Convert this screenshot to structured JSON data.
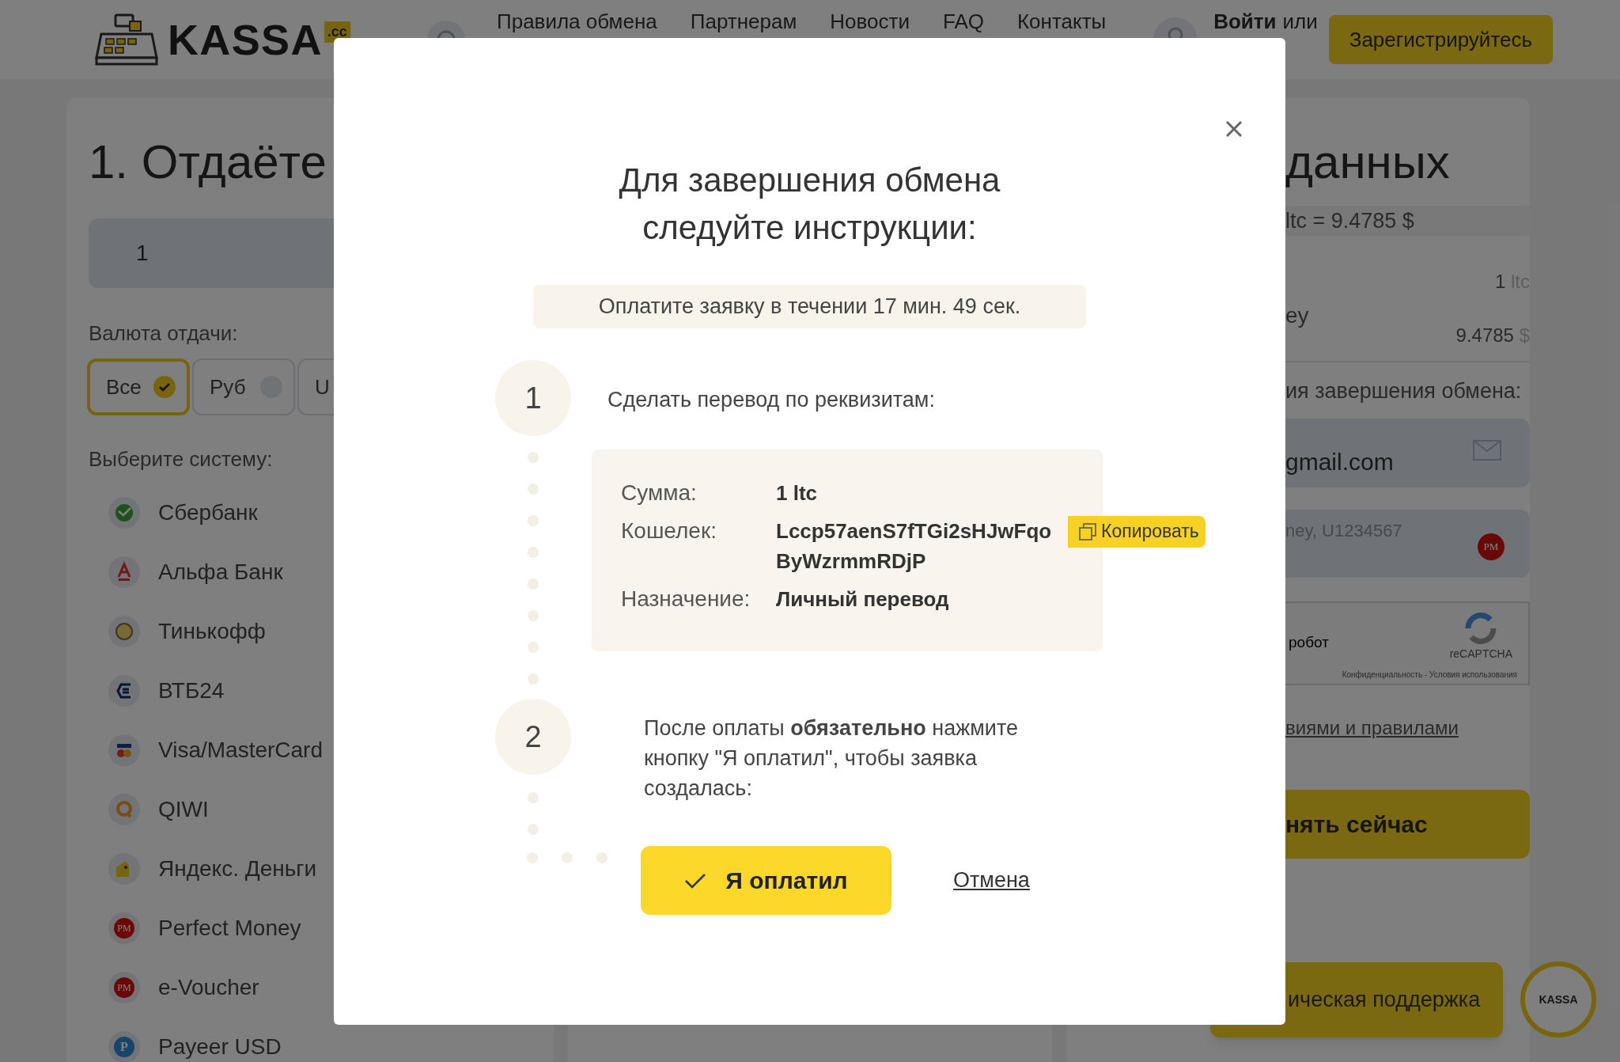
{
  "header": {
    "logo": "KASSA",
    "logo_badge": ".cc",
    "nav": [
      "Правила обмена",
      "Партнерам",
      "Новости",
      "FAQ",
      "Контакты"
    ],
    "login": "Войти",
    "or": "или",
    "register": "Зарегистрируйтесь"
  },
  "left_panel": {
    "title": "1. Отдаёте",
    "amount": "1",
    "currency_label": "Валюта отдачи:",
    "currency_chips": [
      {
        "label": "Все",
        "selected": true
      },
      {
        "label": "Руб",
        "selected": false
      },
      {
        "label": "U",
        "selected": false
      }
    ],
    "system_label": "Выберите систему:",
    "systems": [
      {
        "kind": "sber",
        "label": "Сбербанк"
      },
      {
        "kind": "alfa",
        "label": "Альфа Банк"
      },
      {
        "kind": "tinkoff",
        "label": "Тинькофф"
      },
      {
        "kind": "vtb",
        "label": "ВТБ24"
      },
      {
        "kind": "visa",
        "label": "Visa/MasterCard"
      },
      {
        "kind": "qiwi",
        "label": "QIWI"
      },
      {
        "kind": "yandex",
        "label": "Яндекс. Деньги"
      },
      {
        "kind": "pm",
        "label": "Perfect Money",
        "badge": "PM"
      },
      {
        "kind": "pm",
        "label": "e-Voucher",
        "badge": "PM"
      },
      {
        "kind": "payeer",
        "label": "Payeer USD",
        "badge": "P"
      }
    ]
  },
  "right_panel": {
    "title": "данных",
    "rate": "ltc = 9.4785 $",
    "rows": [
      {
        "label": "",
        "value": "1",
        "unit": "ltc"
      },
      {
        "label": "ey",
        "value": "9.4785",
        "unit": "$"
      }
    ],
    "contact_label": "ия завершения обмена:",
    "email": "gmail.com",
    "wallet_placeholder": "ney, U1234567",
    "wallet_badge": "PM",
    "captcha": {
      "label": "робот",
      "brand": "reCAPTCHA",
      "terms": "Конфиденциальность - Условия использования"
    },
    "terms_link": "виями и правилами",
    "submit": "нять сейчас"
  },
  "support": {
    "label": "ическая поддержка",
    "logo": "KASSA"
  },
  "modal": {
    "title": "Для завершения обмена следуйте инструкции:",
    "timer": "Оплатите заявку в течении 17 мин. 49 сек.",
    "steps": [
      {
        "number": "1",
        "text": "Сделать перевод по реквизитам:"
      },
      {
        "number": "2",
        "text": "После оплаты **обязательно** нажмите кнопку \"Я оплатил\", чтобы заявка создалась:"
      }
    ],
    "details": [
      {
        "label": "Сумма:",
        "value": "1 ltc"
      },
      {
        "label": "Кошелек:",
        "value": "Lccp57aenS7fTGi2sHJwFqo ByWzrmmRDjP",
        "copy": "Копировать"
      },
      {
        "label": "Назначение:",
        "value": "Личный перевод"
      }
    ],
    "confirm": "Я оплатил",
    "cancel": "Отмена"
  }
}
